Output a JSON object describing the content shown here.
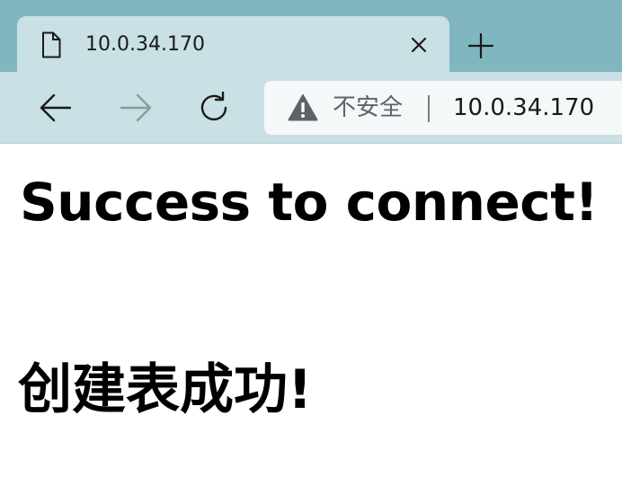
{
  "tab": {
    "title": "10.0.34.170",
    "favicon": "page-icon",
    "close": "close-icon"
  },
  "new_tab": "plus-icon",
  "toolbar": {
    "back": "back-arrow-icon",
    "forward": "forward-arrow-icon",
    "reload": "reload-icon"
  },
  "omnibox": {
    "security_icon": "warning-icon",
    "security_label": "不安全",
    "url": "10.0.34.170"
  },
  "page": {
    "heading1": "Success to connect!",
    "heading2": "创建表成功!"
  },
  "colors": {
    "tab_strip": "#7fb6c0",
    "toolbar": "#c9e0e5",
    "omnibox": "#f4f8f9"
  }
}
